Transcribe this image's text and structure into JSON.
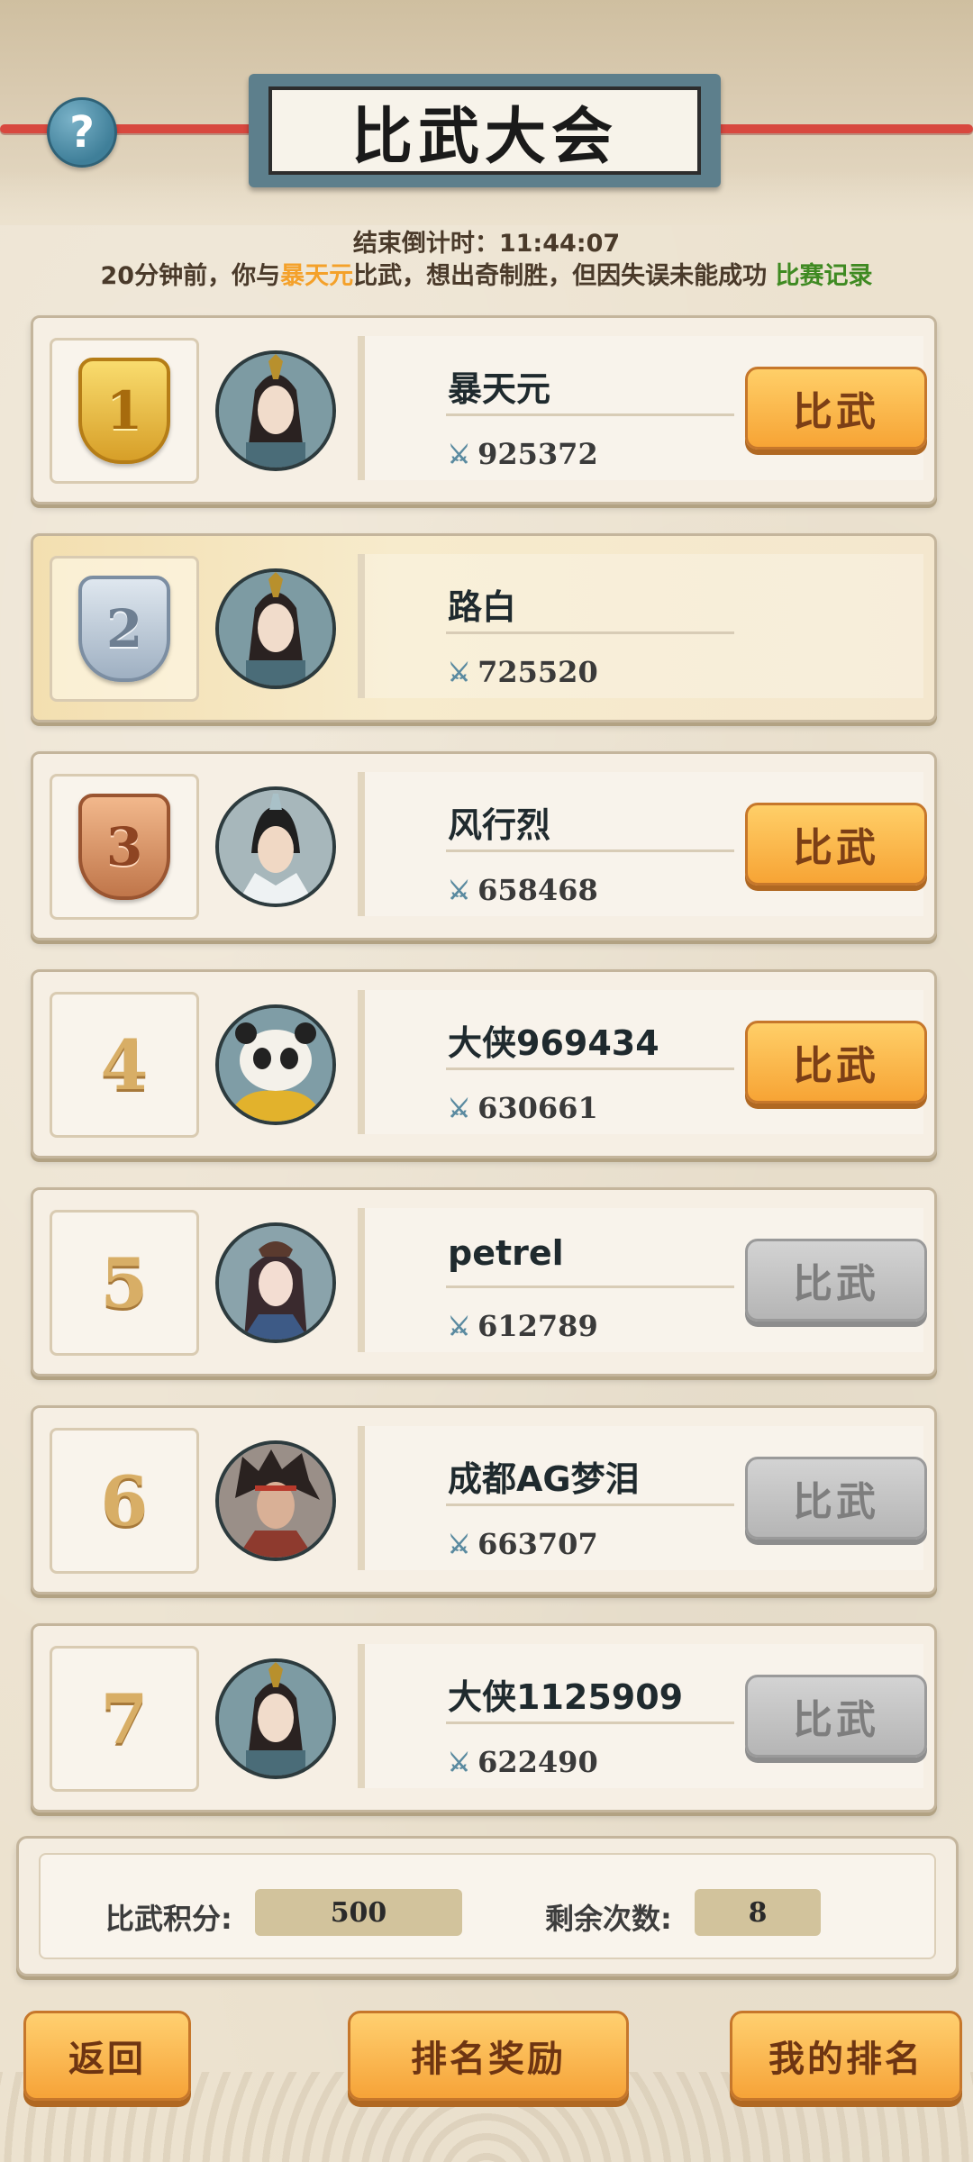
{
  "header": {
    "title": "比武大会",
    "help_icon": "?"
  },
  "info": {
    "countdown_label": "结束倒计时：",
    "countdown_value": "11:44:07",
    "log_prefix": "20分钟前，你与",
    "log_name": "暴天元",
    "log_suffix": "比武，想出奇制胜，但因失误未能成功",
    "log_link": "比赛记录"
  },
  "challenge_label": "比武",
  "players": [
    {
      "rank": "1",
      "name": "暴天元",
      "power": "925372",
      "can_challenge": true
    },
    {
      "rank": "2",
      "name": "路白",
      "power": "725520",
      "can_challenge": null
    },
    {
      "rank": "3",
      "name": "风行烈",
      "power": "658468",
      "can_challenge": true
    },
    {
      "rank": "4",
      "name": "大侠969434",
      "power": "630661",
      "can_challenge": true
    },
    {
      "rank": "5",
      "name": "petrel",
      "power": "612789",
      "can_challenge": false
    },
    {
      "rank": "6",
      "name": "成都AG梦泪",
      "power": "663707",
      "can_challenge": false
    },
    {
      "rank": "7",
      "name": "大侠1125909",
      "power": "622490",
      "can_challenge": false
    }
  ],
  "stats": {
    "score_label": "比武积分:",
    "score_value": "500",
    "remaining_label": "剩余次数:",
    "remaining_value": "8"
  },
  "buttons": {
    "back": "返回",
    "rewards": "排名奖励",
    "my_rank": "我的排名"
  },
  "colors": {
    "highlight_name": "#f4a12a",
    "link": "#3f8a22",
    "button_orange": "#f7a435",
    "button_disabled": "#b5b5b5"
  }
}
